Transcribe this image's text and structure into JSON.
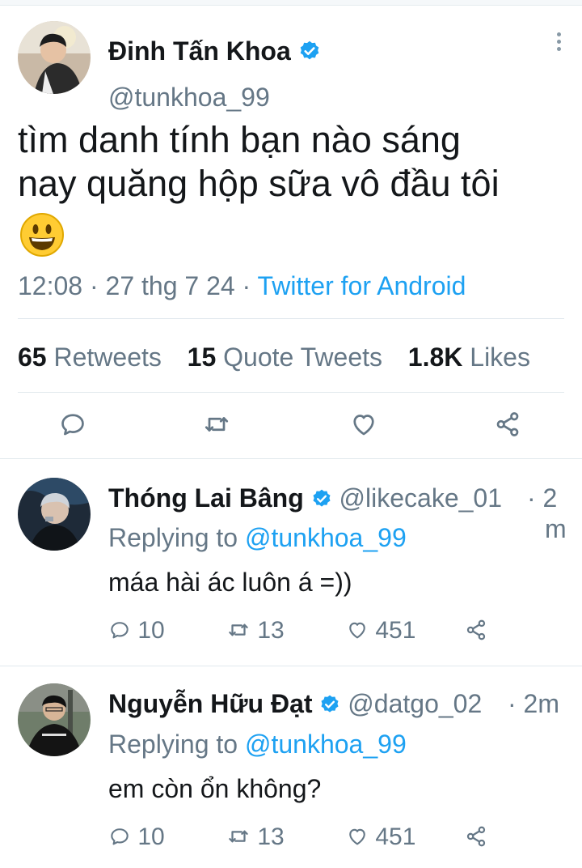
{
  "tweet": {
    "author_name": "Đinh Tấn Khoa",
    "author_handle": "@tunkhoa_99",
    "text_line1": "tìm danh tính bạn nào sáng",
    "text_line2": "nay quăng hộp sữa vô đầu tôi",
    "emoji": "😃",
    "time": "12:08",
    "sep1": " · ",
    "date": "27 thg 7 24",
    "sep2": " · ",
    "source": "Twitter for Android",
    "retweets_count": "65",
    "retweets_label": "Retweets",
    "quotes_count": "15",
    "quotes_label": "Quote Tweets",
    "likes_count": "1.8K",
    "likes_label": "Likes"
  },
  "replies": [
    {
      "name": "Thóng Lai Bâng",
      "handle": "@likecake_01",
      "time_a": "· 2",
      "time_b": "m",
      "replying_prefix": "Replying to ",
      "replying_to": "@tunkhoa_99",
      "text": "máa hài ác luôn á =))",
      "reply_count": "10",
      "retweet_count": "13",
      "like_count": "451"
    },
    {
      "name": "Nguyễn Hữu Đạt",
      "handle": "@datgo_02",
      "time": "· 2m",
      "replying_prefix": "Replying to ",
      "replying_to": "@tunkhoa_99",
      "text": "em còn ổn không?",
      "reply_count": "10",
      "retweet_count": "13",
      "like_count": "451"
    }
  ],
  "colors": {
    "accent": "#1da1f2",
    "text": "#14171a",
    "muted": "#657786",
    "divider": "#e1e8ed"
  },
  "icons": [
    "verified-badge-icon",
    "more-options-icon",
    "reply-icon",
    "retweet-icon",
    "like-icon",
    "share-icon",
    "grinning-face-emoji"
  ]
}
